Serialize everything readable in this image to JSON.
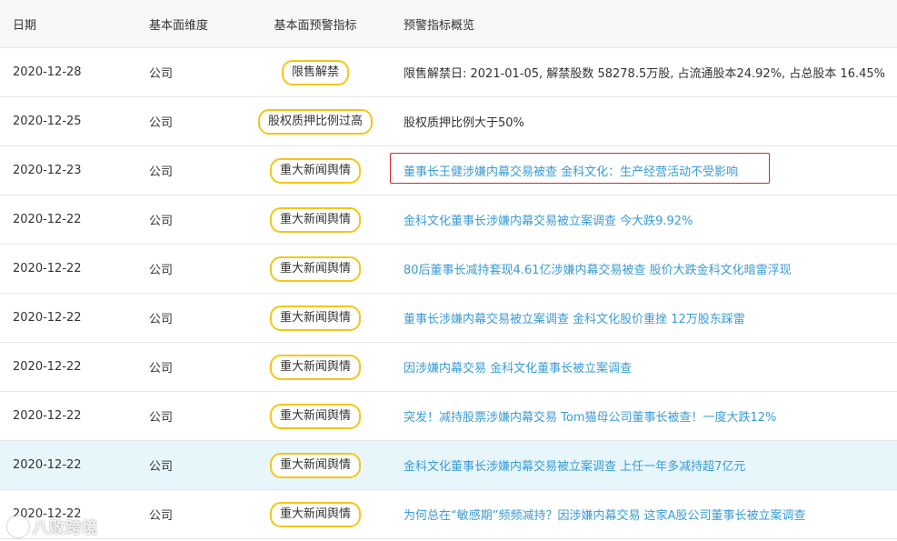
{
  "header": {
    "date": "日期",
    "dimension": "基本面维度",
    "indicator": "基本面预警指标",
    "summary": "预警指标概览"
  },
  "colors": {
    "tag_border": "#f5c518",
    "link": "#3a9bd5",
    "highlight_row": "#e6f6fb",
    "red_box": "#d9262c"
  },
  "rows": [
    {
      "date": "2020-12-28",
      "dimension": "公司",
      "indicator": "限售解禁",
      "summary": "限售解禁日: 2021-01-05, 解禁股数 58278.5万股, 占流通股本24.92%, 占总股本 16.45%"
    },
    {
      "date": "2020-12-25",
      "dimension": "公司",
      "indicator": "股权质押比例过高",
      "summary": "股权质押比例大于50%"
    },
    {
      "date": "2020-12-23",
      "dimension": "公司",
      "indicator": "重大新闻舆情",
      "summary": "董事长王健涉嫌内幕交易被查 金科文化：生产经营活动不受影响"
    },
    {
      "date": "2020-12-22",
      "dimension": "公司",
      "indicator": "重大新闻舆情",
      "summary": "金科文化董事长涉嫌内幕交易被立案调查 今大跌9.92%"
    },
    {
      "date": "2020-12-22",
      "dimension": "公司",
      "indicator": "重大新闻舆情",
      "summary": "80后董事长减持套现4.61亿涉嫌内幕交易被查 股价大跌金科文化暗雷浮现"
    },
    {
      "date": "2020-12-22",
      "dimension": "公司",
      "indicator": "重大新闻舆情",
      "summary": "董事长涉嫌内幕交易被立案调查 金科文化股价重挫 12万股东踩雷"
    },
    {
      "date": "2020-12-22",
      "dimension": "公司",
      "indicator": "重大新闻舆情",
      "summary": "因涉嫌内幕交易 金科文化董事长被立案调查"
    },
    {
      "date": "2020-12-22",
      "dimension": "公司",
      "indicator": "重大新闻舆情",
      "summary": "突发！减持股票涉嫌内幕交易 Tom猫母公司董事长被查！一度大跌12%"
    },
    {
      "date": "2020-12-22",
      "dimension": "公司",
      "indicator": "重大新闻舆情",
      "summary": "金科文化董事长涉嫌内幕交易被立案调查  上任一年多减持超7亿元"
    },
    {
      "date": "2020-12-22",
      "dimension": "公司",
      "indicator": "重大新闻舆情",
      "summary": "为何总在“敏感期”频频减持？因涉嫌内幕交易 这家A股公司董事长被立案调查"
    }
  ],
  "watermark": "八败跨境"
}
